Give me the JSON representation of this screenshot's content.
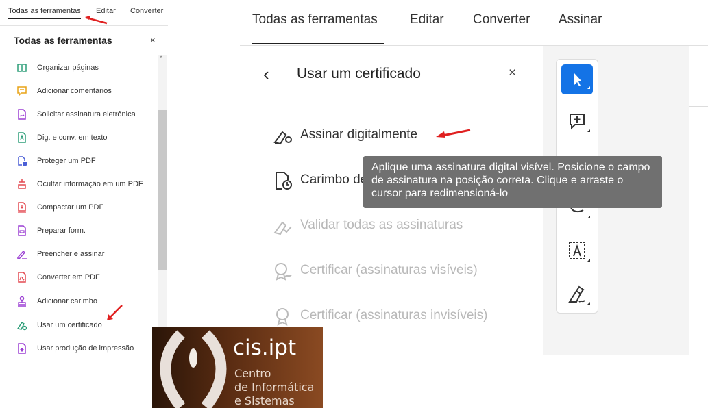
{
  "left_tabs": [
    "Todas as ferramentas",
    "Editar",
    "Converter"
  ],
  "left_panel": {
    "title": "Todas as ferramentas",
    "close": "×",
    "scroll_up": "^",
    "tools": [
      {
        "label": "Organizar páginas",
        "icon": "organize-pages-icon",
        "color": "#2d9d78"
      },
      {
        "label": "Adicionar comentários",
        "icon": "comment-icon",
        "color": "#e8a317"
      },
      {
        "label": "Solicitar assinatura eletrônica",
        "icon": "request-signature-icon",
        "color": "#9b3fd3"
      },
      {
        "label": "Dig. e conv. em texto",
        "icon": "scan-ocr-icon",
        "color": "#2d9d78"
      },
      {
        "label": "Proteger um PDF",
        "icon": "protect-pdf-icon",
        "color": "#4b5fd6"
      },
      {
        "label": "Ocultar informação em um PDF",
        "icon": "redact-icon",
        "color": "#e34850"
      },
      {
        "label": "Compactar um PDF",
        "icon": "compress-pdf-icon",
        "color": "#e34850"
      },
      {
        "label": "Preparar form.",
        "icon": "prepare-form-icon",
        "color": "#9b3fd3"
      },
      {
        "label": "Preencher e assinar",
        "icon": "fill-sign-icon",
        "color": "#9b3fd3"
      },
      {
        "label": "Converter em PDF",
        "icon": "create-pdf-icon",
        "color": "#e34850"
      },
      {
        "label": "Adicionar carimbo",
        "icon": "stamp-icon",
        "color": "#9b3fd3"
      },
      {
        "label": "Usar um certificado",
        "icon": "certificate-icon",
        "color": "#2d9d78"
      },
      {
        "label": "Usar produção de impressão",
        "icon": "print-production-icon",
        "color": "#9b3fd3"
      }
    ]
  },
  "main_tabs": [
    "Todas as ferramentas",
    "Editar",
    "Converter",
    "Assinar"
  ],
  "certificate_panel": {
    "back": "‹",
    "title": "Usar um certificado",
    "close": "×",
    "items": [
      {
        "label": "Assinar digitalmente",
        "icon": "digital-sign-icon",
        "enabled": true
      },
      {
        "label": "Carimbo de hora",
        "icon": "timestamp-icon",
        "enabled": true
      },
      {
        "label": "Validar todas as assinaturas",
        "icon": "validate-signatures-icon",
        "enabled": false
      },
      {
        "label": "Certificar (assinaturas visíveis)",
        "icon": "certify-visible-icon",
        "enabled": false
      },
      {
        "label": "Certificar (assinaturas invisíveis)",
        "icon": "certify-invisible-icon",
        "enabled": false
      }
    ]
  },
  "tooltip": "Aplique uma assinatura digital visível. Posicione o campo de assinatura na posição correta. Clique e arraste o cursor para redimensioná-lo",
  "right_toolbar": [
    {
      "icon": "select-cursor-icon",
      "active": true
    },
    {
      "icon": "add-comment-icon",
      "active": false
    },
    {
      "icon": "draw-icon",
      "active": false
    },
    {
      "icon": "link-icon",
      "active": false
    },
    {
      "icon": "text-box-icon",
      "active": false
    },
    {
      "icon": "sign-icon",
      "active": false
    }
  ],
  "logo": {
    "brand": "cis.ipt",
    "lines": [
      "Centro",
      "de Informática",
      "e Sistemas"
    ]
  },
  "colors": {
    "accent": "#1473e6",
    "annotation": "#e02020"
  }
}
